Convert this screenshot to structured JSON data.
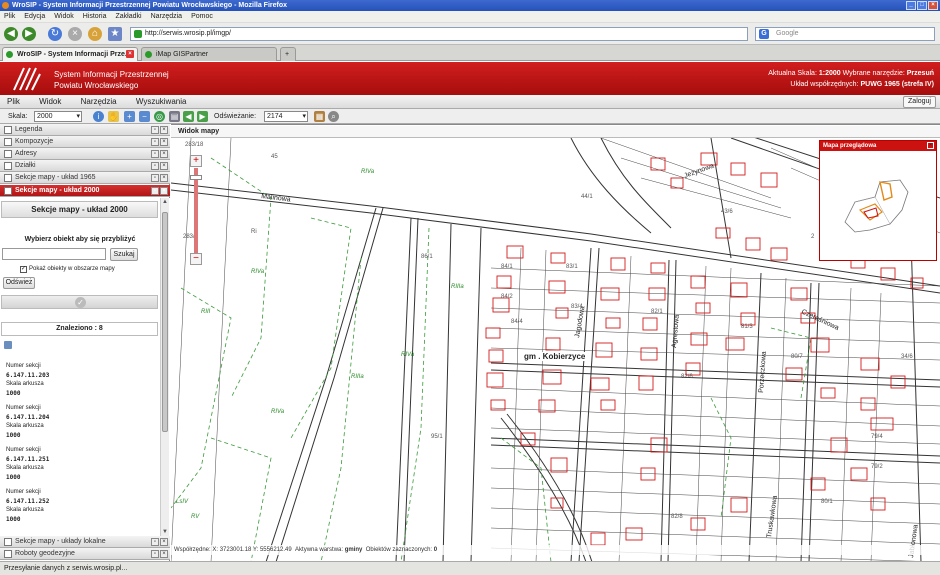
{
  "browser": {
    "title": "WroSIP - System Informacji Przestrzennej Powiatu Wrocławskiego - Mozilla Firefox",
    "menu": [
      "Plik",
      "Edycja",
      "Widok",
      "Historia",
      "Zakładki",
      "Narzędzia",
      "Pomoc"
    ],
    "url": "http://serwis.wrosip.pl/imgp/",
    "search_placeholder": "Google",
    "tabs": [
      {
        "label": "WroSIP - System Informacji Prze..."
      },
      {
        "label": "iMap GISPartner"
      }
    ],
    "status": "Przesyłanie danych z serwis.wrosip.pl..."
  },
  "app": {
    "title_line1": "System Informacji Przestrzennej",
    "title_line2": "Powiatu Wrocławskiego",
    "scale_label": "Aktualna Skala:",
    "scale_value": "1:2000",
    "tool_label": "Wybrane narzędzie:",
    "tool_value": "Przesuń",
    "crs_label": "Układ współrzędnych:",
    "crs_value": "PUWG 1965 (strefa IV)",
    "menu": [
      "Plik",
      "Widok",
      "Narzędzia",
      "Wyszukiwania"
    ],
    "login_label": "Zaloguj"
  },
  "toolbar": {
    "scale_label": "Skala:",
    "scale_value": "2000",
    "refresh_label": "Odświeżanie:",
    "refresh_value": "2174"
  },
  "left_panel": {
    "sections": [
      "Legenda",
      "Kompozycje",
      "Adresy",
      "Działki",
      "Sekcje mapy - układ 1965",
      "Sekcje mapy - układ 2000"
    ],
    "active_section": "Sekcje mapy - układ 2000",
    "panel_title": "Sekcje mapy - układ 2000",
    "instruction": "Wybierz obiekt aby się przybliżyć",
    "search_button": "Szukaj",
    "show_in_area": "Pokaż obiekty w obszarze mapy",
    "refresh_button": "Odśwież",
    "found_label": "Znaleziono : 8",
    "results": [
      {
        "label": "Numer sekcji",
        "number": "6.147.11.203",
        "scale_label": "Skala arkusza",
        "scale": "1000"
      },
      {
        "label": "Numer sekcji",
        "number": "6.147.11.204",
        "scale_label": "Skala arkusza",
        "scale": "1000"
      },
      {
        "label": "Numer sekcji",
        "number": "6.147.11.251",
        "scale_label": "Skala arkusza",
        "scale": "1000"
      },
      {
        "label": "Numer sekcji",
        "number": "6.147.11.252",
        "scale_label": "Skala arkusza",
        "scale": "1000"
      }
    ],
    "bottom_sections": [
      "Sekcje mapy - układy lokalne",
      "Roboty geodezyjne"
    ]
  },
  "map": {
    "title": "Widok mapy",
    "overview_title": "Mapa przeglądowa",
    "gmina_label": "gm . Kobierzyce",
    "street_labels": [
      "Malinowa",
      "Jeżynowa",
      "Agrestowa",
      "Jagodowa",
      "Porzeczkowa",
      "Czereśniowa",
      "Truskawkowa",
      "Jabłonowa"
    ],
    "coords_label": "Współrzędne:",
    "coords_x": "X: 3723001.18",
    "coords_y": "Y: 5556212.49",
    "active_layer_label": "Aktywna warstwa:",
    "active_layer": "gminy",
    "selected_label": "Obiektów zaznaczonych:",
    "selected_count": "0"
  }
}
